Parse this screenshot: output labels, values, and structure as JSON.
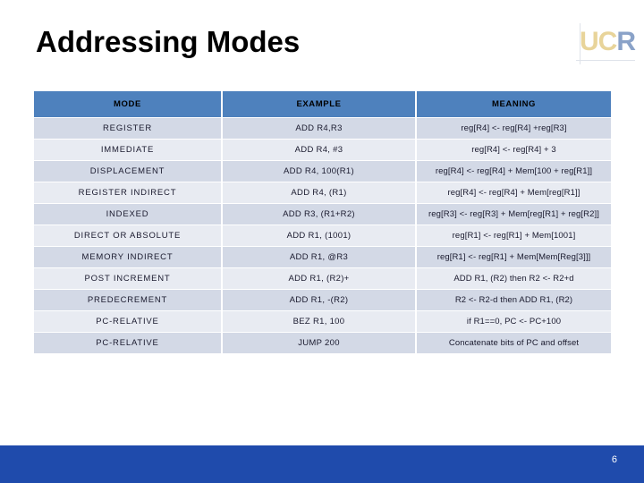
{
  "slide": {
    "title": "Addressing Modes",
    "page_number": "6",
    "accent_header_color": "#4e81bd",
    "row_dark_color": "#d3d9e6",
    "row_light_color": "#e8ebf2",
    "footer_color": "#1f4bac"
  },
  "logo": {
    "letter_u": "U",
    "letter_c": "C",
    "letter_r": "R",
    "gold_color": "#e8d49a",
    "blue_color": "#8aa2c8"
  },
  "table": {
    "headers": [
      "MODE",
      "EXAMPLE",
      "MEANING"
    ],
    "rows": [
      {
        "mode": "REGISTER",
        "example": "ADD R4,R3",
        "meaning": "reg[R4] <- reg[R4] +reg[R3]"
      },
      {
        "mode": "IMMEDIATE",
        "example": "ADD R4, #3",
        "meaning": "reg[R4] <- reg[R4] + 3"
      },
      {
        "mode": "DISPLACEMENT",
        "example": "ADD R4, 100(R1)",
        "meaning": "reg[R4] <- reg[R4] + Mem[100 + reg[R1]]"
      },
      {
        "mode": "REGISTER INDIRECT",
        "example": "ADD R4, (R1)",
        "meaning": "reg[R4] <- reg[R4] + Mem[reg[R1]]"
      },
      {
        "mode": "INDEXED",
        "example": "ADD R3, (R1+R2)",
        "meaning": "reg[R3] <- reg[R3] + Mem[reg[R1] + reg[R2]]"
      },
      {
        "mode": "DIRECT OR ABSOLUTE",
        "example": "ADD R1, (1001)",
        "meaning": "reg[R1] <- reg[R1] + Mem[1001]"
      },
      {
        "mode": "MEMORY INDIRECT",
        "example": "ADD R1, @R3",
        "meaning": "reg[R1] <- reg[R1] + Mem[Mem[Reg[3]]]"
      },
      {
        "mode": "POST INCREMENT",
        "example": "ADD R1, (R2)+",
        "meaning": "ADD R1, (R2) then R2 <- R2+d"
      },
      {
        "mode": "PREDECREMENT",
        "example": "ADD R1, -(R2)",
        "meaning": "R2 <- R2-d then ADD R1, (R2)"
      },
      {
        "mode": "PC-RELATIVE",
        "example": "BEZ R1, 100",
        "meaning": "if R1==0, PC <- PC+100"
      },
      {
        "mode": "PC-RELATIVE",
        "example": "JUMP 200",
        "meaning": "Concatenate bits of PC and offset"
      }
    ]
  }
}
